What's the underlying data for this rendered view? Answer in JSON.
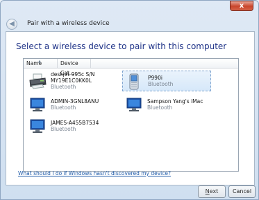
{
  "window": {
    "title": "Pair with a wireless device",
    "close_glyph": "x"
  },
  "content": {
    "heading": "Select a wireless device to pair with this computer",
    "columns": [
      "Name",
      "Device Cat..."
    ],
    "devices": [
      {
        "name_line1": "deskjet 995c S/N",
        "name_line2": "MY19E1C0KK0L",
        "type": "Bluetooth",
        "icon": "printer-icon",
        "selected": false
      },
      {
        "name_line1": "P990i",
        "name_line2": "",
        "type": "Bluetooth",
        "icon": "phone-icon",
        "selected": true
      },
      {
        "name_line1": "ADMIN-3GNL8ANU",
        "name_line2": "",
        "type": "Bluetooth",
        "icon": "computer-icon",
        "selected": false
      },
      {
        "name_line1": "Sampson Yang's iMac",
        "name_line2": "",
        "type": "Bluetooth",
        "icon": "computer-icon",
        "selected": false
      },
      {
        "name_line1": "JAMES-A455B7534",
        "name_line2": "",
        "type": "Bluetooth",
        "icon": "computer-icon",
        "selected": false
      }
    ],
    "help_link": "What should I do if Windows hasn't discovered my device?"
  },
  "buttons": {
    "next_prefix": "N",
    "next_rest": "ext",
    "cancel": "Cancel"
  }
}
